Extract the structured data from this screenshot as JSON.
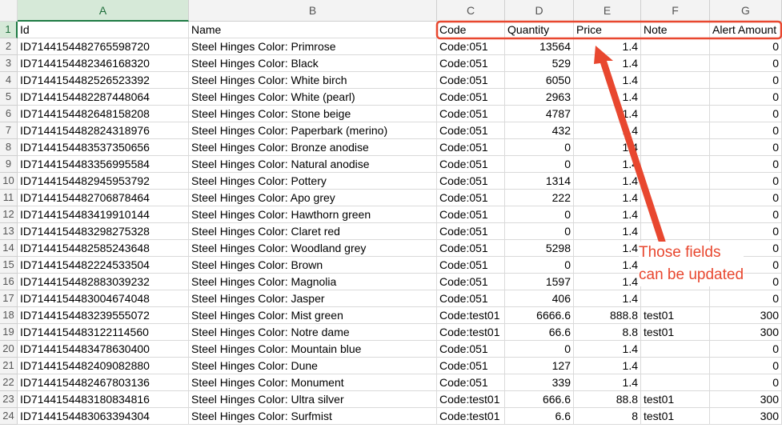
{
  "columns": [
    "A",
    "B",
    "C",
    "D",
    "E",
    "F",
    "G"
  ],
  "rows": [
    [
      "Id",
      "Name",
      "Code",
      "Quantity",
      "Price",
      "Note",
      "Alert Amount"
    ],
    [
      "ID7144154482765598720",
      "Steel Hinges Color: Primrose",
      "Code:051",
      "13564",
      "1.4",
      "",
      "0"
    ],
    [
      "ID7144154482346168320",
      "Steel Hinges Color: Black",
      "Code:051",
      "529",
      "1.4",
      "",
      "0"
    ],
    [
      "ID7144154482526523392",
      "Steel Hinges Color: White birch",
      "Code:051",
      "6050",
      "1.4",
      "",
      "0"
    ],
    [
      "ID7144154482287448064",
      "Steel Hinges Color: White (pearl)",
      "Code:051",
      "2963",
      "1.4",
      "",
      "0"
    ],
    [
      "ID7144154482648158208",
      "Steel Hinges Color: Stone beige",
      "Code:051",
      "4787",
      "1.4",
      "",
      "0"
    ],
    [
      "ID7144154482824318976",
      "Steel Hinges Color: Paperbark (merino)",
      "Code:051",
      "432",
      "1.4",
      "",
      "0"
    ],
    [
      "ID7144154483537350656",
      "Steel Hinges Color: Bronze anodise",
      "Code:051",
      "0",
      "1.4",
      "",
      "0"
    ],
    [
      "ID7144154483356995584",
      "Steel Hinges Color: Natural anodise",
      "Code:051",
      "0",
      "1.4",
      "",
      "0"
    ],
    [
      "ID7144154482945953792",
      "Steel Hinges Color: Pottery",
      "Code:051",
      "1314",
      "1.4",
      "",
      "0"
    ],
    [
      "ID7144154482706878464",
      "Steel Hinges Color: Apo grey",
      "Code:051",
      "222",
      "1.4",
      "",
      "0"
    ],
    [
      "ID7144154483419910144",
      "Steel Hinges Color: Hawthorn green",
      "Code:051",
      "0",
      "1.4",
      "",
      "0"
    ],
    [
      "ID7144154483298275328",
      "Steel Hinges Color: Claret red",
      "Code:051",
      "0",
      "1.4",
      "",
      "0"
    ],
    [
      "ID7144154482585243648",
      "Steel Hinges Color: Woodland grey",
      "Code:051",
      "5298",
      "1.4",
      "",
      "0"
    ],
    [
      "ID7144154482224533504",
      "Steel Hinges Color: Brown",
      "Code:051",
      "0",
      "1.4",
      "",
      "0"
    ],
    [
      "ID7144154482883039232",
      "Steel Hinges Color: Magnolia",
      "Code:051",
      "1597",
      "1.4",
      "",
      "0"
    ],
    [
      "ID7144154483004674048",
      "Steel Hinges Color: Jasper",
      "Code:051",
      "406",
      "1.4",
      "",
      "0"
    ],
    [
      "ID7144154483239555072",
      "Steel Hinges Color: Mist green",
      "Code:test01",
      "6666.6",
      "888.8",
      "test01",
      "300"
    ],
    [
      "ID7144154483122114560",
      "Steel Hinges Color: Notre dame",
      "Code:test01",
      "66.6",
      "8.8",
      "test01",
      "300"
    ],
    [
      "ID7144154483478630400",
      "Steel Hinges Color: Mountain blue",
      "Code:051",
      "0",
      "1.4",
      "",
      "0"
    ],
    [
      "ID7144154482409082880",
      "Steel Hinges Color: Dune",
      "Code:051",
      "127",
      "1.4",
      "",
      "0"
    ],
    [
      "ID7144154482467803136",
      "Steel Hinges Color: Monument",
      "Code:051",
      "339",
      "1.4",
      "",
      "0"
    ],
    [
      "ID7144154483180834816",
      "Steel Hinges Color: Ultra silver",
      "Code:test01",
      "666.6",
      "88.8",
      "test01",
      "300"
    ],
    [
      "ID7144154483063394304",
      "Steel Hinges Color: Surfmist",
      "Code:test01",
      "6.6",
      "8",
      "test01",
      "300"
    ]
  ],
  "annotation": {
    "lines": [
      "Those fields",
      "can be updated"
    ],
    "color": "#e8472f"
  },
  "colors": {
    "selected_header_bg": "#d6e9d8",
    "selected_header_text": "#1e6e3a",
    "header_bg": "#f3f3f3",
    "gridline": "#dadada"
  }
}
